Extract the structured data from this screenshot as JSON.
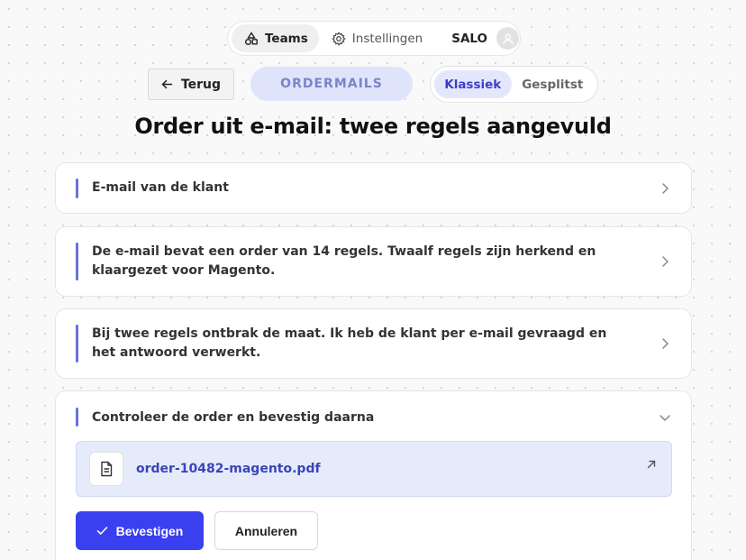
{
  "nav": {
    "teams_label": "Teams",
    "settings_label": "Instellingen",
    "user_label": "SALO"
  },
  "toolbar": {
    "back_label": "Terug",
    "section_label": "ORDERMAILS",
    "view_options": [
      "Klassiek",
      "Gesplitst"
    ],
    "active_view": "Klassiek"
  },
  "page_title": "Order uit e-mail: twee regels aangevuld",
  "steps": [
    {
      "text": "E-mail van de klant",
      "expanded": false
    },
    {
      "text": "De e-mail bevat een order van 14 regels. Twaalf regels zijn herkend en klaargezet voor Magento.",
      "expanded": false
    },
    {
      "text": "Bij twee regels ontbrak de maat. Ik heb de klant per e-mail gevraagd en het antwoord verwerkt.",
      "expanded": false
    },
    {
      "text": "Controleer de order en bevestig daarna",
      "expanded": true
    }
  ],
  "attachment": {
    "file_name": "order-10482-magento.pdf"
  },
  "actions": {
    "confirm_label": "Bevestigen",
    "cancel_label": "Annuleren"
  },
  "colors": {
    "accent": "#3a3ff0",
    "accent_soft": "#e4e7fb",
    "step_bar": "#6a72d8",
    "link": "#3a44b8"
  },
  "icons": {
    "teams": "shapes-icon",
    "settings": "gear-icon",
    "avatar": "user-icon",
    "back": "arrow-left-icon",
    "collapsed": "chevron-right-icon",
    "expanded": "chevron-down-icon",
    "file": "document-icon",
    "open": "arrow-up-right-icon",
    "confirm": "check-icon"
  }
}
